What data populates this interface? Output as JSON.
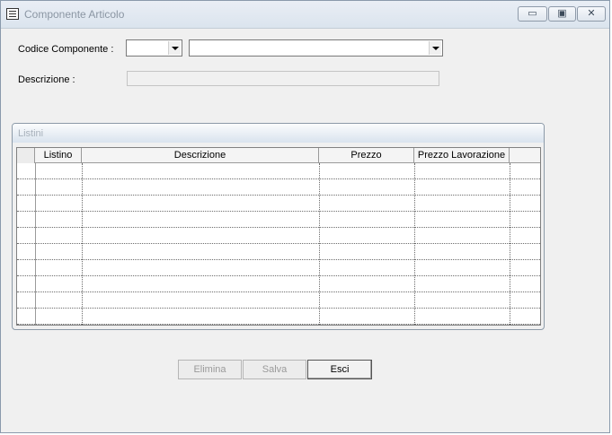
{
  "window": {
    "title": "Componente Articolo",
    "minimize_glyph": "▭",
    "maximize_glyph": "▣",
    "close_glyph": "✕"
  },
  "form": {
    "codice_label": "Codice Componente  :",
    "descrizione_label": "Descrizione  :",
    "codice_value": "",
    "componente_value": "",
    "descrizione_value": ""
  },
  "listini": {
    "title": "Listini",
    "columns": [
      "Listino",
      "Descrizione",
      "Prezzo",
      "Prezzo Lavorazione"
    ]
  },
  "buttons": {
    "elimina": "Elimina",
    "salva": "Salva",
    "esci": "Esci"
  },
  "icons": {
    "app": "window-app-icon",
    "dropdown": "chevron-down-icon"
  }
}
